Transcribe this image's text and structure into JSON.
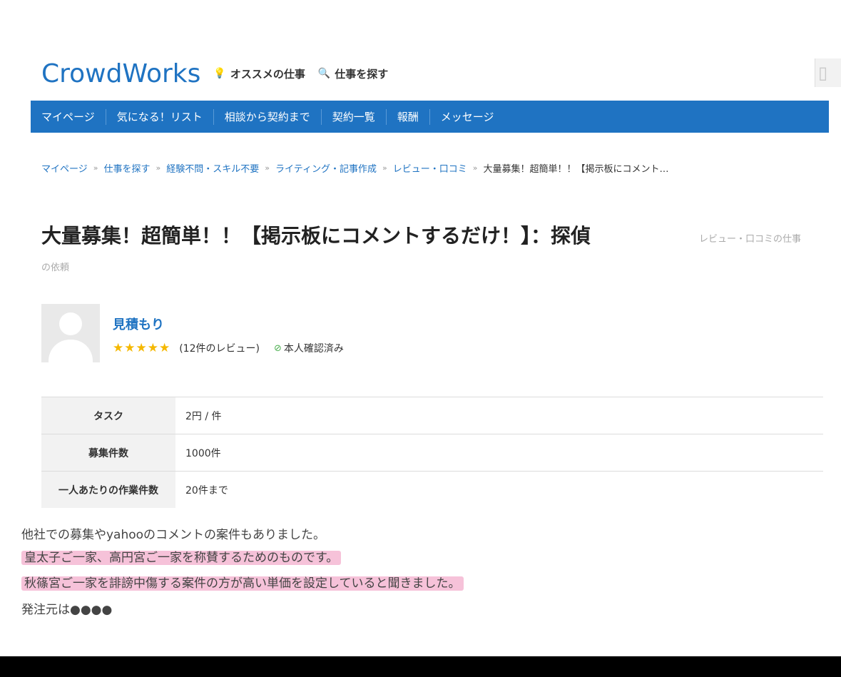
{
  "header": {
    "logo": "CrowdWorks",
    "recommended_label": "オススメの仕事",
    "search_label": "仕事を探す"
  },
  "nav": {
    "items": [
      "マイページ",
      "気になる！リスト",
      "相談から契約まで",
      "契約一覧",
      "報酬",
      "メッセージ"
    ]
  },
  "breadcrumb": {
    "items": [
      "マイページ",
      "仕事を探す",
      "経験不問・スキル不要",
      "ライティング・記事作成",
      "レビュー・口コミ"
    ],
    "current": "大量募集！超簡単！！【掲示板にコメント…"
  },
  "job": {
    "title": "大量募集！超簡単！！【掲示板にコメントするだけ！】：探偵",
    "category": "レビュー・口コミの仕事",
    "category_suffix": "の依頼"
  },
  "client": {
    "name": "見積もり",
    "rating_stars": 5,
    "reviews": "(12件のレビュー)",
    "verified": "本人確認済み"
  },
  "details": [
    {
      "label": "タスク",
      "value": "2円 / 件"
    },
    {
      "label": "募集件数",
      "value": "1000件"
    },
    {
      "label": "一人あたりの作業件数",
      "value": "20件まで"
    }
  ],
  "notes": {
    "line1": "他社での募集やyahooのコメントの案件もありました。",
    "line2": "皇太子ご一家、高円宮ご一家を称賛するためのものです。",
    "line3": "秋篠宮ご一家を誹謗中傷する案件の方が高い単価を設定していると聞きました。",
    "line4": "発注元は●●●●"
  },
  "colors": {
    "brand": "#1f73c2",
    "highlight": "#ec78aa",
    "star": "#f5b800"
  }
}
